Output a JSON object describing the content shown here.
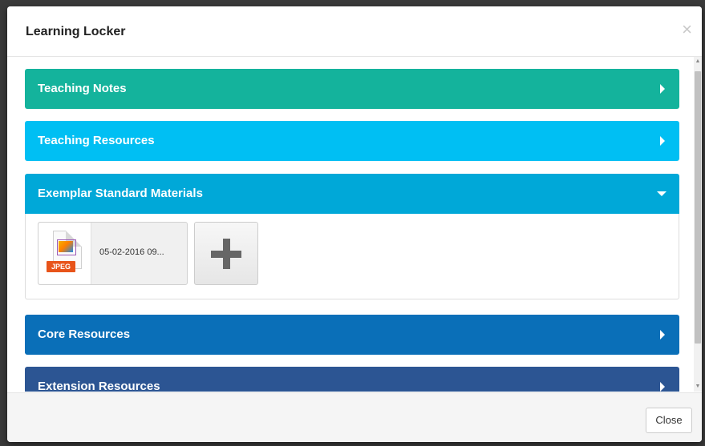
{
  "modal": {
    "title": "Learning Locker",
    "close_label": "Close"
  },
  "panels": [
    {
      "label": "Teaching Notes",
      "color": "#14b39c",
      "expanded": false
    },
    {
      "label": "Teaching Resources",
      "color": "#00bff3",
      "expanded": false
    },
    {
      "label": "Exemplar Standard Materials",
      "color": "#00a8d8",
      "expanded": true
    },
    {
      "label": "Core Resources",
      "color": "#0a6fb8",
      "expanded": false
    },
    {
      "label": "Extension Resources",
      "color": "#2c5593",
      "expanded": false
    }
  ],
  "file_item": {
    "type_badge": "JPEG",
    "name": "05-02-2016 09..."
  },
  "icons": {
    "close": "close-icon",
    "collapsed": "caret-right-icon",
    "expanded": "caret-down-icon",
    "file": "image-file-icon",
    "add": "plus-icon"
  }
}
